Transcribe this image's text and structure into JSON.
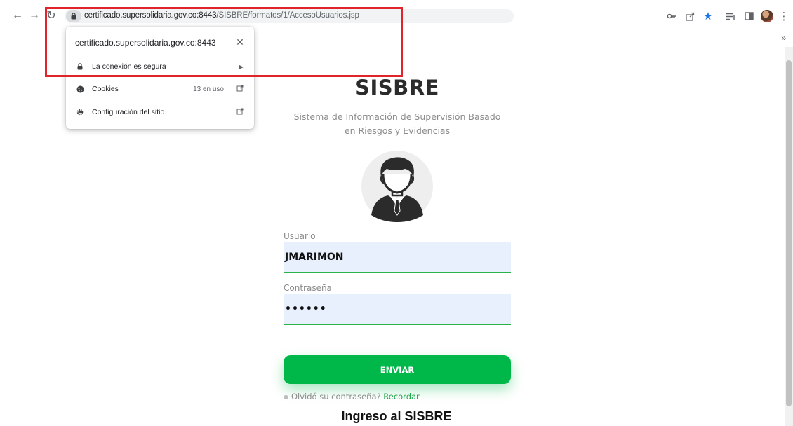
{
  "browser": {
    "url_host": "certificado.supersolidaria.gov.co:8443",
    "url_path": "/SISBRE/formatos/1/AccesoUsuarios.jsp",
    "bookmarks_more": "»"
  },
  "site_info_popup": {
    "title": "certificado.supersolidaria.gov.co:8443",
    "close": "✕",
    "rows": [
      {
        "label": "La conexión es segura",
        "count": "",
        "icon": "lock-icon"
      },
      {
        "label": "Cookies",
        "count": "13 en uso",
        "icon": "cookie-icon"
      },
      {
        "label": "Configuración del sitio",
        "count": "",
        "icon": "gear-icon"
      }
    ]
  },
  "login": {
    "title": "SISBRE",
    "subtitle_line1": "Sistema de Información de Supervisión Basado",
    "subtitle_line2": "en Riesgos y Evidencias",
    "user_label": "Usuario",
    "user_value": "JMARIMON",
    "password_label": "Contraseña",
    "password_value": "••••••",
    "submit_label": "ENVIAR",
    "forgot_text": "Olvidó su contraseña?",
    "forgot_link": "Recordar"
  },
  "caption": "Ingreso al SISBRE",
  "colors": {
    "accent_green": "#00b74a",
    "field_bg": "#e8f0fe",
    "annotation_red": "#e1242a",
    "bookmark_star": "#1a73e8"
  }
}
